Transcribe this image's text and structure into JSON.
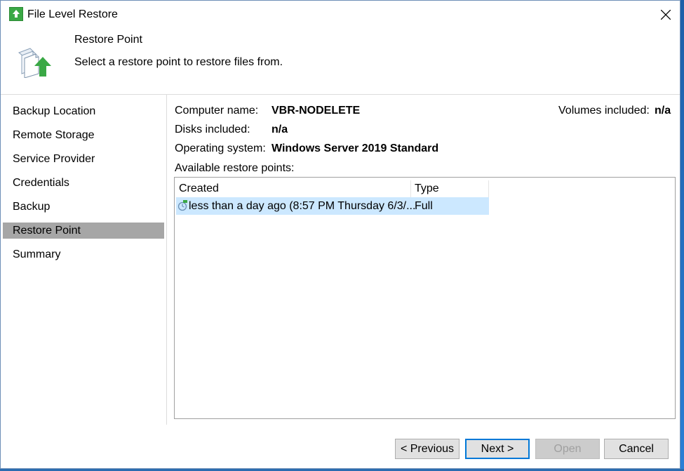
{
  "window": {
    "title": "File Level Restore"
  },
  "header": {
    "title": "Restore Point",
    "description": "Select a restore point to restore files from."
  },
  "sidebar": {
    "items": [
      {
        "label": "Backup Location"
      },
      {
        "label": "Remote Storage"
      },
      {
        "label": "Service Provider"
      },
      {
        "label": "Credentials"
      },
      {
        "label": "Backup"
      },
      {
        "label": "Restore Point",
        "active": true
      },
      {
        "label": "Summary"
      }
    ]
  },
  "details": {
    "computer_name_label": "Computer name:",
    "computer_name_value": "VBR-NODELETE",
    "volumes_label": "Volumes included:",
    "volumes_value": "n/a",
    "disks_label": "Disks included:",
    "disks_value": "n/a",
    "os_label": "Operating system:",
    "os_value": "Windows Server 2019 Standard",
    "restore_points_label": "Available restore points:"
  },
  "restore_points": {
    "columns": [
      "Created",
      "Type"
    ],
    "rows": [
      {
        "created": "less than a day ago (8:57 PM Thursday 6/3/...",
        "type": "Full",
        "icon": "restore-point-icon"
      }
    ]
  },
  "buttons": {
    "previous": "< Previous",
    "next": "Next >",
    "open": "Open",
    "cancel": "Cancel"
  },
  "colors": {
    "selection": "#cce8ff",
    "active_nav": "#a6a6a6",
    "accent": "#0078d7",
    "icon_green": "#3aa845"
  }
}
